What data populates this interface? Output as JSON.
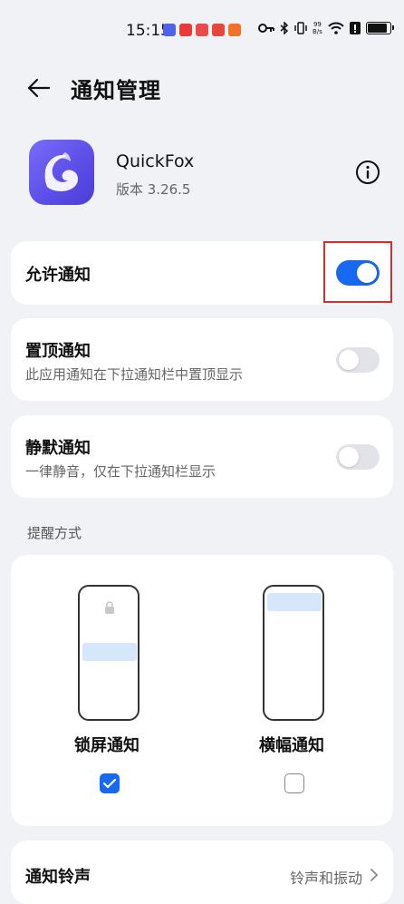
{
  "status_bar": {
    "time": "15:15",
    "net_speed_top": "99",
    "net_speed_bottom": "B/s",
    "notification_colors": [
      "#4f63e8",
      "#e83a3a",
      "#e94a4a",
      "#e8463a",
      "#f0732a"
    ]
  },
  "header": {
    "title": "通知管理"
  },
  "app": {
    "name": "QuickFox",
    "version": "版本 3.26.5"
  },
  "settings": {
    "allow": {
      "label": "允许通知",
      "enabled": true
    },
    "pinned": {
      "label": "置顶通知",
      "desc": "此应用通知在下拉通知栏中置顶显示",
      "enabled": false
    },
    "silent": {
      "label": "静默通知",
      "desc": "一律静音，仅在下拉通知栏显示",
      "enabled": false
    }
  },
  "reminder": {
    "section_title": "提醒方式",
    "lock_screen": {
      "label": "锁屏通知",
      "checked": true
    },
    "banner": {
      "label": "横幅通知",
      "checked": false
    }
  },
  "ringtone": {
    "label": "通知铃声",
    "value": "铃声和振动"
  },
  "colors": {
    "accent": "#1769f2",
    "background": "#f1f2f6",
    "highlight": "#e02a2a"
  }
}
